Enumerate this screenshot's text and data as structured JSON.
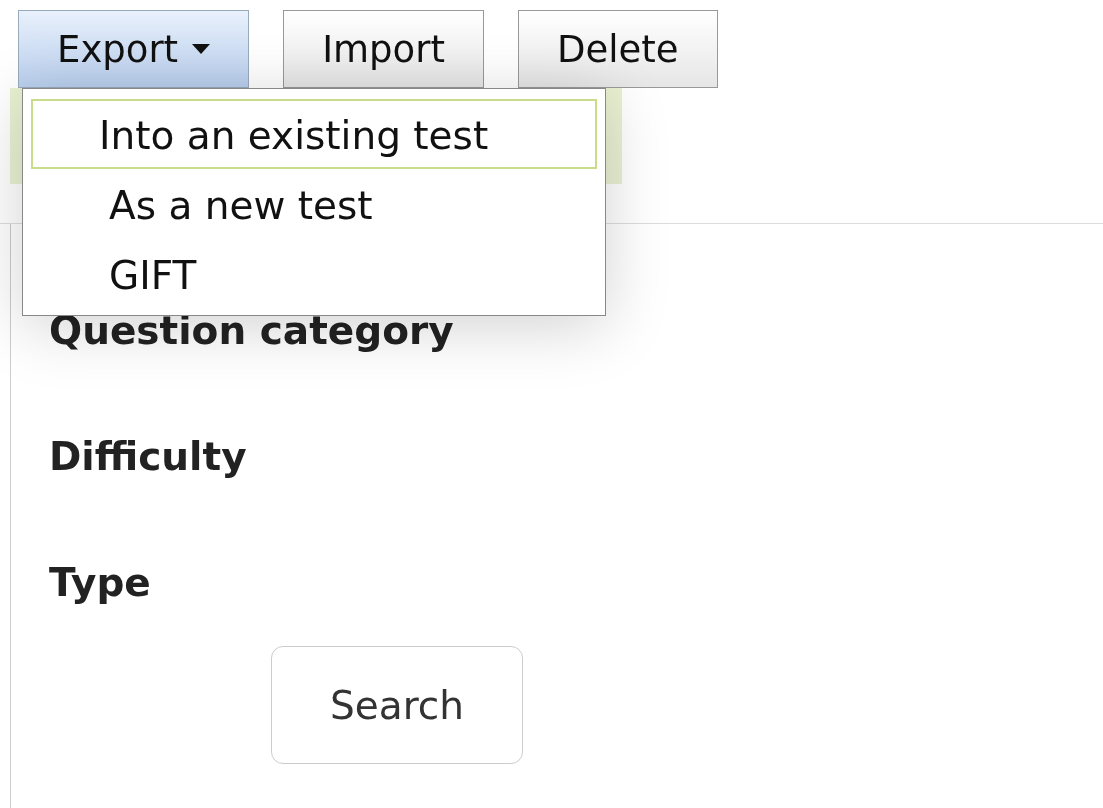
{
  "toolbar": {
    "buttons": [
      {
        "label": "Export",
        "kind": "dropdown",
        "selected": true
      },
      {
        "label": "Import",
        "kind": "plain",
        "selected": false
      },
      {
        "label": "Delete",
        "kind": "plain",
        "selected": false
      }
    ]
  },
  "export_menu": {
    "items": [
      {
        "label": "Into an existing test",
        "selected": true
      },
      {
        "label": "As a new test",
        "selected": false
      },
      {
        "label": "GIFT",
        "selected": false
      }
    ]
  },
  "filters": [
    {
      "label": "Question category"
    },
    {
      "label": "Difficulty"
    },
    {
      "label": "Type"
    }
  ],
  "search_button": {
    "label": "Search"
  }
}
